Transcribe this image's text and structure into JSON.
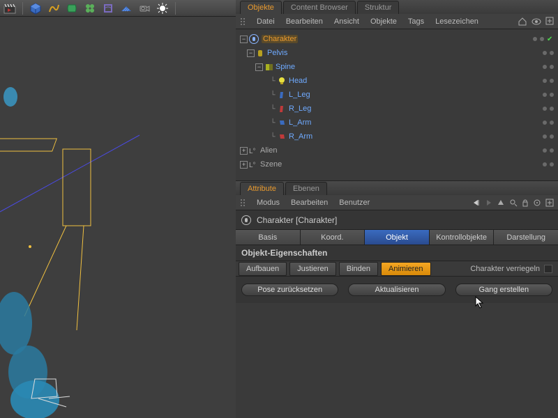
{
  "top_tabs": {
    "objects": "Objekte",
    "content_browser": "Content Browser",
    "struktur": "Struktur"
  },
  "obj_menu": {
    "datei": "Datei",
    "bearbeiten": "Bearbeiten",
    "ansicht": "Ansicht",
    "objekte": "Objekte",
    "tags": "Tags",
    "lesezeichen": "Lesezeichen"
  },
  "hierarchy": {
    "charakter": "Charakter",
    "pelvis": "Pelvis",
    "spine": "Spine",
    "head": "Head",
    "l_leg": "L_Leg",
    "r_leg": "R_Leg",
    "l_arm": "L_Arm",
    "r_arm": "R_Arm",
    "alien": "Alien",
    "szene": "Szene"
  },
  "attr_tabs": {
    "attribute": "Attribute",
    "ebenen": "Ebenen"
  },
  "attr_menu": {
    "modus": "Modus",
    "bearbeiten": "Bearbeiten",
    "benutzer": "Benutzer"
  },
  "obj_header": "Charakter [Charakter]",
  "subtabs": {
    "basis": "Basis",
    "koord": "Koord.",
    "objekt": "Objekt",
    "kontroll": "Kontrollobjekte",
    "darst": "Darstellung"
  },
  "section_title": "Objekt-Eigenschaften",
  "subtabs2": {
    "aufbauen": "Aufbauen",
    "justieren": "Justieren",
    "binden": "Binden",
    "animieren": "Animieren"
  },
  "lock_label": "Charakter verriegeln",
  "buttons": {
    "reset": "Pose zurücksetzen",
    "update": "Aktualisieren",
    "create": "Gang erstellen"
  }
}
